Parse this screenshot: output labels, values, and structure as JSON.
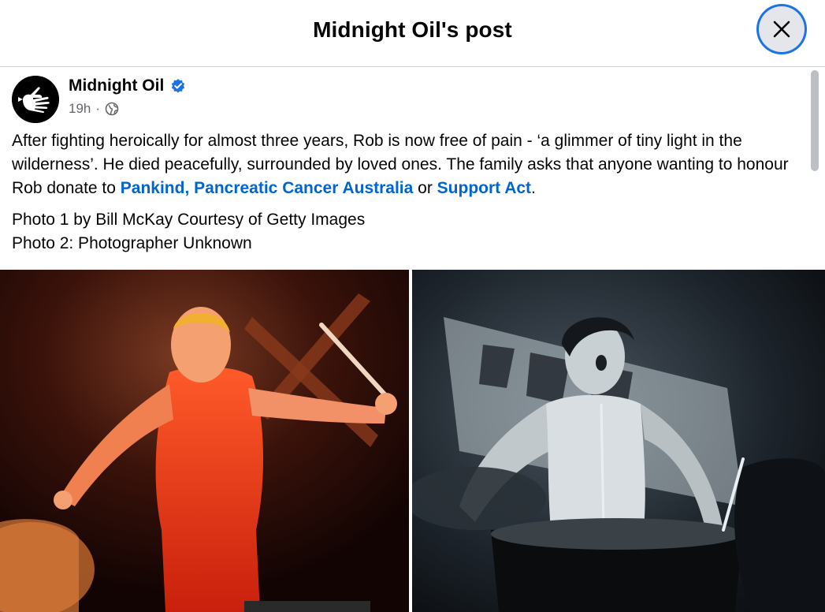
{
  "header": {
    "title": "Midnight Oil's post"
  },
  "post": {
    "author": "Midnight Oil",
    "verified_icon": "verified-badge-icon",
    "time": "19h",
    "separator": "·",
    "audience_icon": "globe-icon",
    "text_before_links": "After fighting heroically for almost three years, Rob is now free of pain - ‘a glimmer of tiny light in the wilderness’. He died peacefully, surrounded by loved ones. The family asks that anyone wanting to honour Rob donate to ",
    "link1": "Pankind, Pancreatic Cancer Australia",
    "text_between_links": " or ",
    "link2": "Support Act",
    "text_after_links": ".",
    "credit_line1": "Photo 1 by Bill McKay Courtesy of Getty Images",
    "credit_line2": "Photo 2: Photographer Unknown"
  },
  "photos": [
    {
      "name": "drummer-red-photo"
    },
    {
      "name": "drummer-bw-photo"
    }
  ],
  "colors": {
    "link": "#0064d1",
    "verified": "#1b74e4",
    "close_ring": "#1b74e4"
  }
}
